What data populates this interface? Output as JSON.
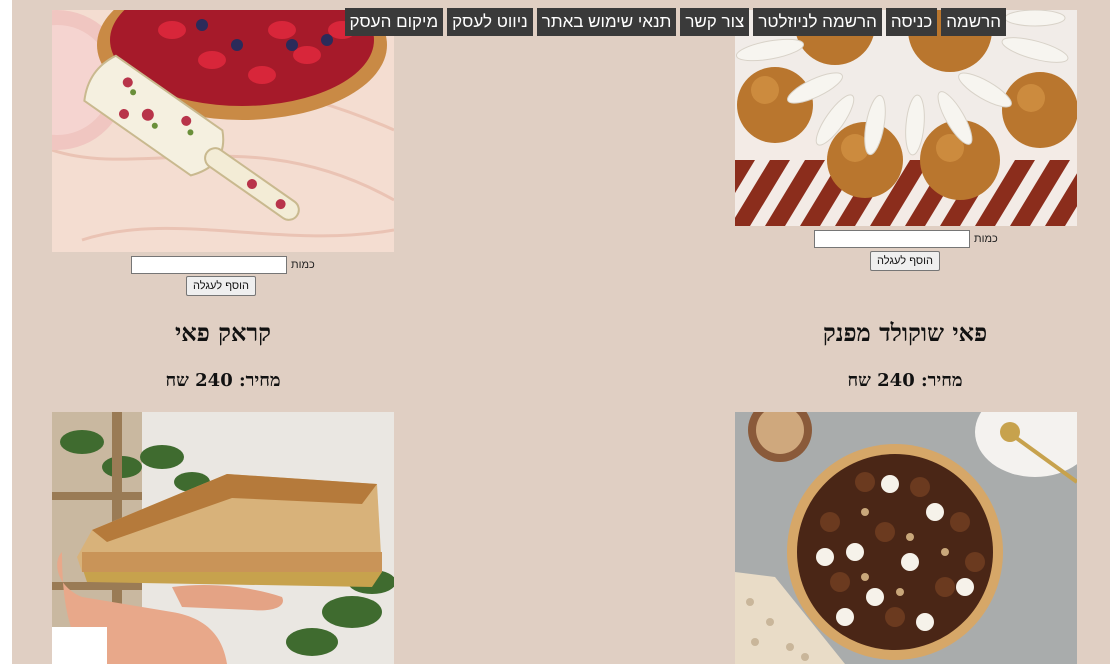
{
  "nav": {
    "items": [
      {
        "label": "מיקום העסק"
      },
      {
        "label": "ניווט לעסק"
      },
      {
        "label": "תנאי שימוש באתר"
      },
      {
        "label": "צור קשר"
      },
      {
        "label": "הרשמה לניוזלטר"
      },
      {
        "label": "כניסה"
      },
      {
        "label": "הרשמה"
      }
    ]
  },
  "products_top": {
    "right": {
      "qty_label": "כמות",
      "qty_value": "",
      "add_label": "הוסף לעגלה"
    },
    "left": {
      "qty_label": "כמות",
      "qty_value": "",
      "add_label": "הוסף לעגלה"
    }
  },
  "products_bottom": {
    "right": {
      "name": "פאי שוקולד מפנק",
      "price": "מחיר: 240 שח"
    },
    "left": {
      "name": "קראק פאי",
      "price": "מחיר: 240 שח"
    }
  }
}
